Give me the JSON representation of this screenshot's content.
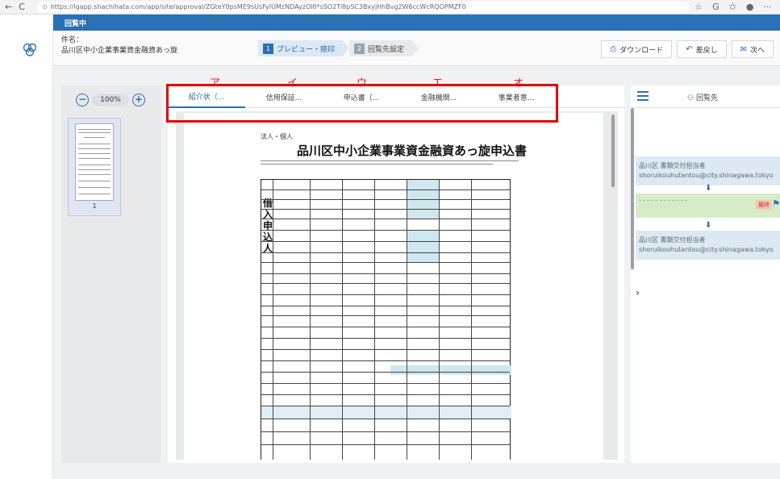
{
  "browser": {
    "url": "https://lgapp.shachihata.com/app/site/approval/ZGteY0psME9sUsFyIUMzNDAyzOl0*sSO2Ti8pSC3BxyjHhBvg2W6ccWcRQOPMZF0",
    "nav_back": "←",
    "nav_reload": "C",
    "icons": [
      "☆",
      "G",
      "✩",
      "●",
      "···"
    ]
  },
  "topbar": {
    "title": "回覧中"
  },
  "subject": {
    "label": "件名：",
    "value": "品川区中小企業事業資金融資あっ旋"
  },
  "steps": [
    {
      "num": "1",
      "label": "プレビュー・捺印"
    },
    {
      "num": "2",
      "label": "回覧先設定"
    }
  ],
  "actions": {
    "download": "ダウンロード",
    "sendback": "差戻し",
    "next": "次へ",
    "download_icon": "⎙",
    "sendback_icon": "↶",
    "next_icon": "✉"
  },
  "zoom": {
    "minus": "−",
    "value": "100%",
    "plus": "+"
  },
  "thumbnail": {
    "page_number": "1"
  },
  "tabs": [
    {
      "label": "紹介状（...",
      "kana": "ア"
    },
    {
      "label": "信用保証...",
      "kana": "イ"
    },
    {
      "label": "申込書（...",
      "kana": "ウ"
    },
    {
      "label": "金融機関...",
      "kana": "エ"
    },
    {
      "label": "事業者意...",
      "kana": "オ"
    }
  ],
  "document": {
    "subheader": "法人・個人",
    "title": "品川区中小企業事業資金融資あっ旋申込書",
    "side_label": [
      "借",
      "入",
      "申",
      "込",
      "人"
    ]
  },
  "right_pane": {
    "title": "回覧先",
    "route": [
      {
        "dept": "品川区 書類交付担当者",
        "email": "shoruikouhutantou@city.shinagawa.tokyo"
      },
      {
        "dept": "品川区 書類交付担当者",
        "email": "shoruikouhutantou@city.shinagawa.tokyo"
      }
    ],
    "current_tag": "最終"
  },
  "colors": {
    "accent": "#2b6fb5",
    "annotation": "#e60000",
    "route_bg": "#dbe9f4",
    "current_bg": "#d6ebc8"
  }
}
